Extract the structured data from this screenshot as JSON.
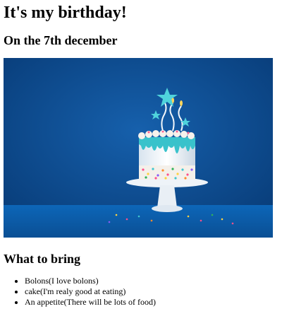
{
  "page": {
    "title": "It's my birthday!",
    "subtitle": "On the 7th december"
  },
  "hero_image": {
    "subject": "birthday-cake-with-stars-photo",
    "background_color": "#0b4a8f",
    "table_color": "#0a5fb0",
    "accent_color": "#3fc7cf"
  },
  "bring": {
    "heading": "What to bring",
    "items": [
      {
        "text": "Bolons(I love bolons)"
      },
      {
        "text": "cake(I'm realy good at eating)"
      },
      {
        "text": "An appetite(There will be lots of food)"
      }
    ]
  }
}
